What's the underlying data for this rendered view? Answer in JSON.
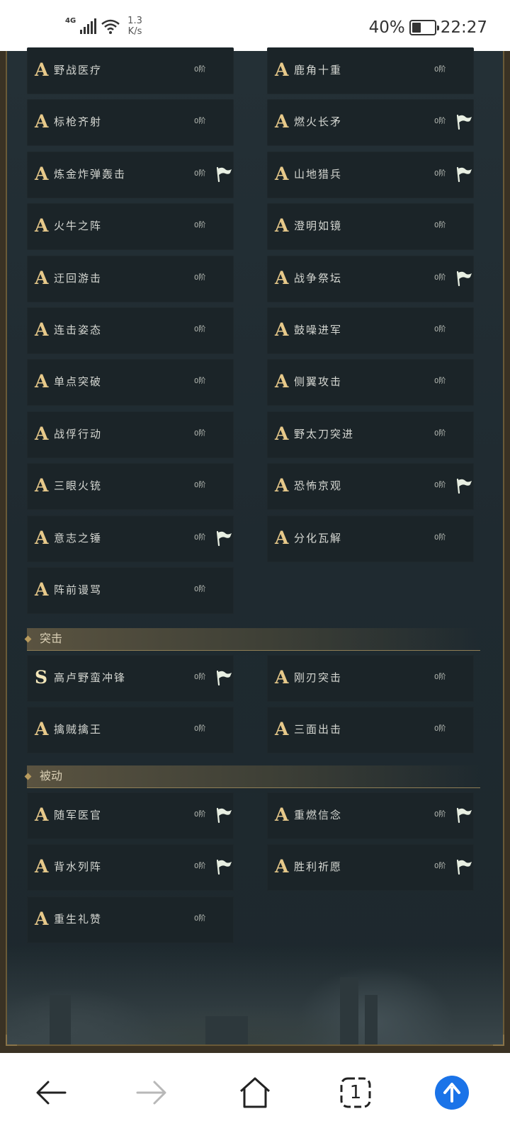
{
  "status_bar": {
    "network": "4G",
    "speed_value": "1.3",
    "speed_unit": "K/s",
    "battery_text": "40%",
    "battery_level": 0.4,
    "time": "22:27"
  },
  "cards_col1": [
    {
      "grade": "A",
      "name": "野战医疗",
      "level": "0阶",
      "flag": false
    },
    {
      "grade": "A",
      "name": "标枪齐射",
      "level": "0阶",
      "flag": false
    },
    {
      "grade": "A",
      "name": "炼金炸弹轰击",
      "level": "0阶",
      "flag": true
    },
    {
      "grade": "A",
      "name": "火牛之阵",
      "level": "0阶",
      "flag": false
    },
    {
      "grade": "A",
      "name": "迂回游击",
      "level": "0阶",
      "flag": false
    },
    {
      "grade": "A",
      "name": "连击姿态",
      "level": "0阶",
      "flag": false
    },
    {
      "grade": "A",
      "name": "单点突破",
      "level": "0阶",
      "flag": false
    },
    {
      "grade": "A",
      "name": "战俘行动",
      "level": "0阶",
      "flag": false
    },
    {
      "grade": "A",
      "name": "三眼火铳",
      "level": "0阶",
      "flag": false
    },
    {
      "grade": "A",
      "name": "意志之锤",
      "level": "0阶",
      "flag": true
    },
    {
      "grade": "A",
      "name": "阵前谩骂",
      "level": "0阶",
      "flag": false
    }
  ],
  "cards_col2": [
    {
      "grade": "A",
      "name": "鹿角十重",
      "level": "0阶",
      "flag": false
    },
    {
      "grade": "A",
      "name": "燃火长矛",
      "level": "0阶",
      "flag": true
    },
    {
      "grade": "A",
      "name": "山地猎兵",
      "level": "0阶",
      "flag": true
    },
    {
      "grade": "A",
      "name": "澄明如镜",
      "level": "0阶",
      "flag": false
    },
    {
      "grade": "A",
      "name": "战争祭坛",
      "level": "0阶",
      "flag": true
    },
    {
      "grade": "A",
      "name": "鼓噪进军",
      "level": "0阶",
      "flag": false
    },
    {
      "grade": "A",
      "name": "侧翼攻击",
      "level": "0阶",
      "flag": false
    },
    {
      "grade": "A",
      "name": "野太刀突进",
      "level": "0阶",
      "flag": false
    },
    {
      "grade": "A",
      "name": "恐怖京观",
      "level": "0阶",
      "flag": true
    },
    {
      "grade": "A",
      "name": "分化瓦解",
      "level": "0阶",
      "flag": false
    }
  ],
  "sections": [
    {
      "title": "突击",
      "cards": [
        {
          "grade": "S",
          "name": "高卢野蛮冲锋",
          "level": "0阶",
          "flag": true
        },
        {
          "grade": "A",
          "name": "刚刃突击",
          "level": "0阶",
          "flag": false
        },
        {
          "grade": "A",
          "name": "擒贼擒王",
          "level": "0阶",
          "flag": false
        },
        {
          "grade": "A",
          "name": "三面出击",
          "level": "0阶",
          "flag": false
        }
      ]
    },
    {
      "title": "被动",
      "cards": [
        {
          "grade": "A",
          "name": "随军医官",
          "level": "0阶",
          "flag": true
        },
        {
          "grade": "A",
          "name": "重燃信念",
          "level": "0阶",
          "flag": true
        },
        {
          "grade": "A",
          "name": "背水列阵",
          "level": "0阶",
          "flag": true
        },
        {
          "grade": "A",
          "name": "胜利祈愿",
          "level": "0阶",
          "flag": true
        },
        {
          "grade": "A",
          "name": "重生礼赞",
          "level": "0阶",
          "flag": false
        }
      ]
    }
  ],
  "nav": {
    "back_icon": "arrow-left-icon",
    "forward_icon": "arrow-right-icon",
    "home_icon": "home-icon",
    "tabs_count": "1",
    "scroll_top_icon": "arrow-up-circle-icon",
    "accent_color": "#1a73e8"
  },
  "colors": {
    "grade_a": "#e7c98a",
    "grade_s": "#f2e6b9",
    "card_bg": "#1b2428",
    "panel_bg": "#243036"
  }
}
